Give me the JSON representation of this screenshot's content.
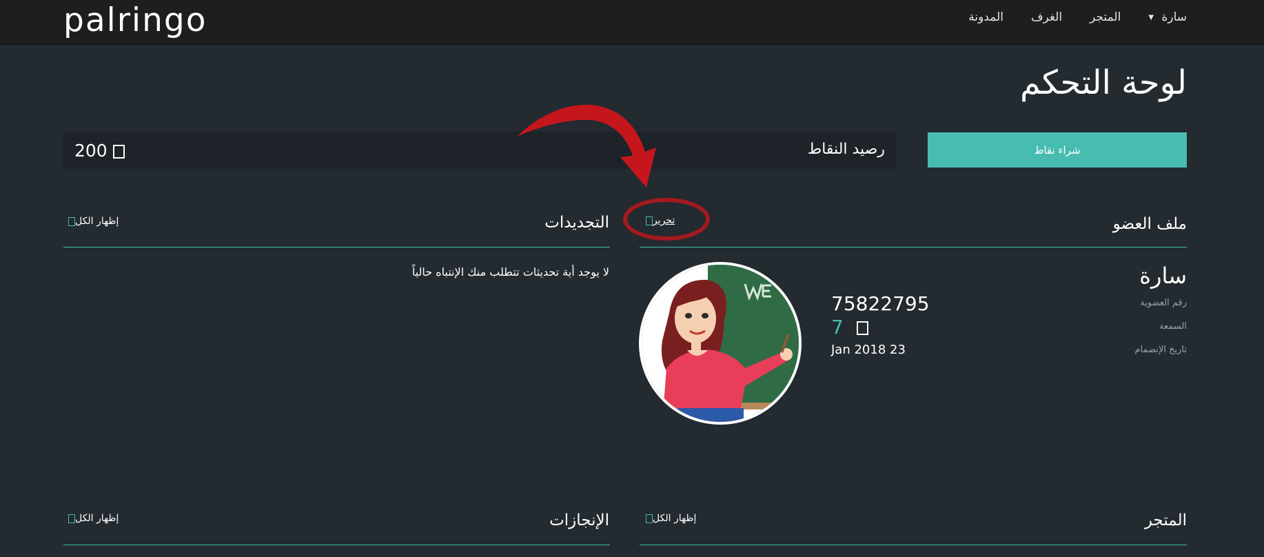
{
  "brand": {
    "logo": "palringo"
  },
  "nav": {
    "user": "سارة",
    "store": "المتجر",
    "rooms": "الغرف",
    "blog": "المدونة"
  },
  "page": {
    "title": "لوحة التحكم"
  },
  "points": {
    "label": "رصيد النقاط",
    "value": "200",
    "buy_label": "شراء نقاط"
  },
  "profile": {
    "title": "ملف العضو",
    "edit_label": "تحرير",
    "name": "سارة",
    "member_id_label": "رقم العضوية",
    "member_id": "75822795",
    "reputation_label": "السمعة",
    "reputation": "7",
    "join_date_label": "تاريخ الإنضمام",
    "join_date": "Jan 2018 23"
  },
  "updates": {
    "title": "التجديدات",
    "show_all": "إظهار الكل",
    "empty_message": "لا يوجد أية تحديثات تتطلب منك الإنتباه حالياً"
  },
  "store_section": {
    "title": "المتجر",
    "show_all": "إظهار الكل"
  },
  "achievements": {
    "title": "الإنجازات",
    "show_all": "إظهار الكل"
  },
  "colors": {
    "accent": "#48bcb0",
    "background": "#232a30",
    "topbar": "#1e1e1e",
    "annotation": "#c4161c"
  }
}
